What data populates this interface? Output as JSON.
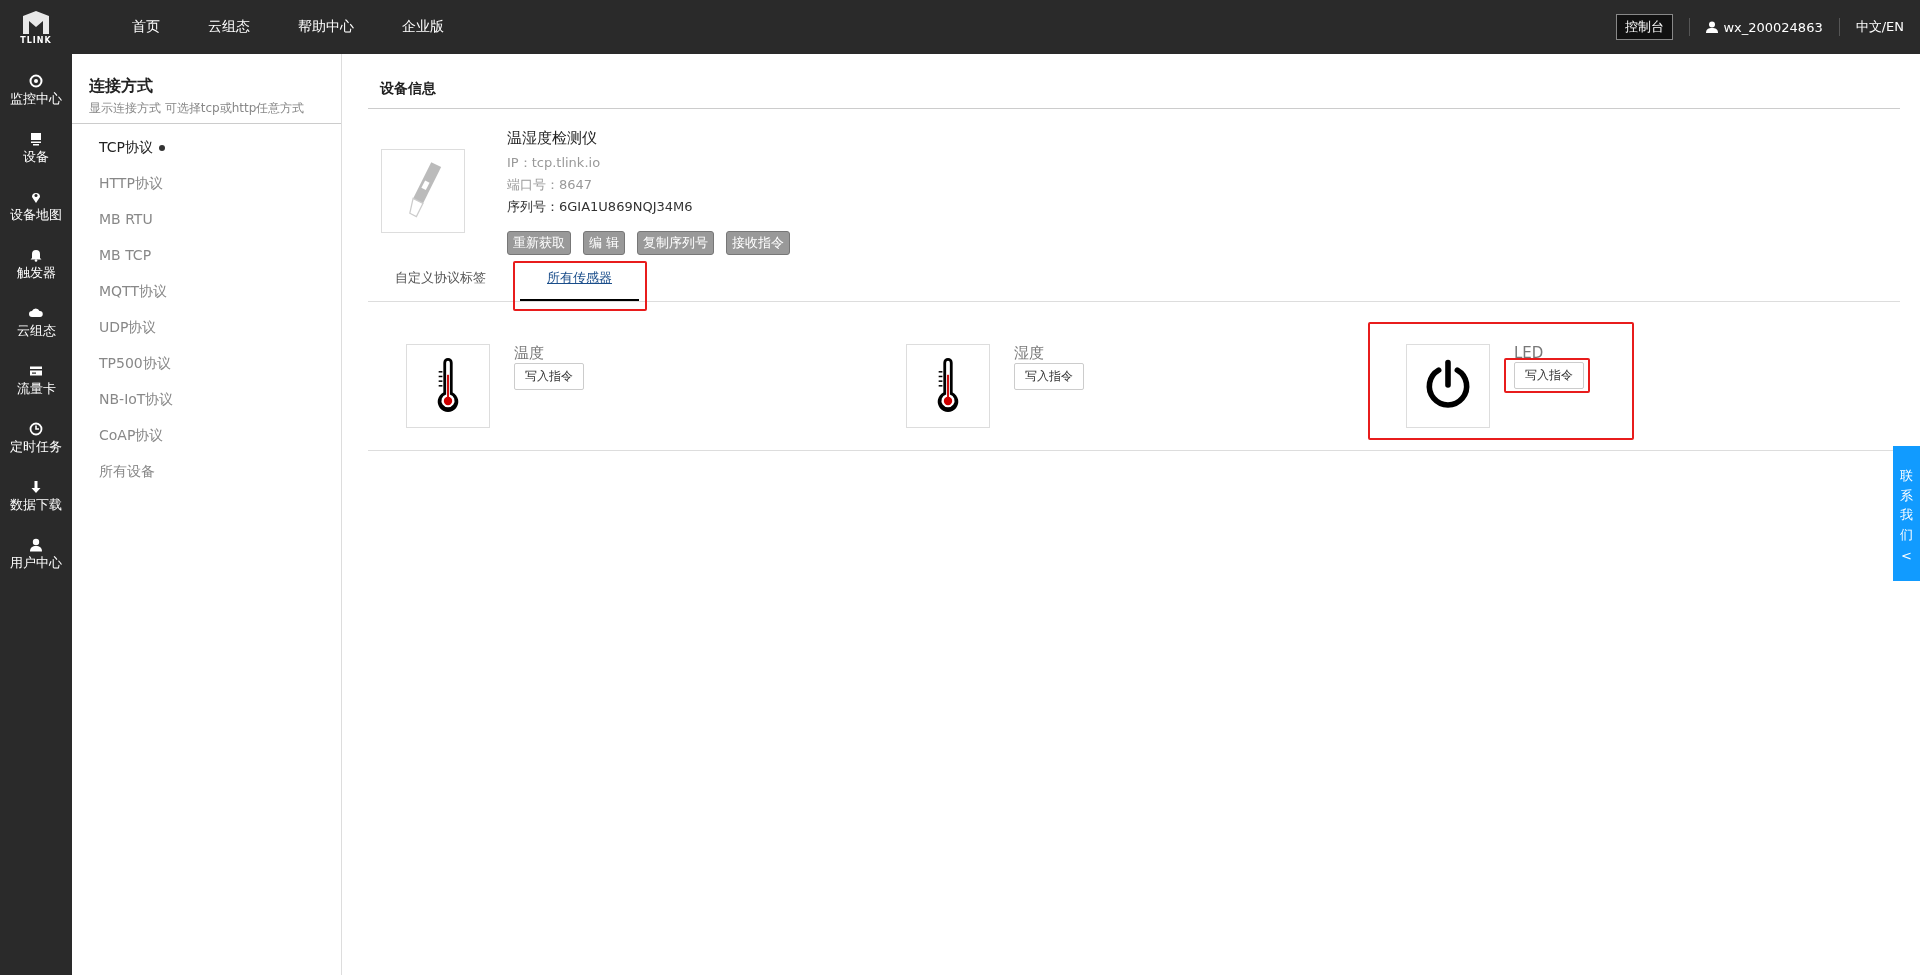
{
  "top_nav": {
    "logo_text": "TLINK",
    "items": [
      "首页",
      "云组态",
      "帮助中心",
      "企业版"
    ],
    "console_button": "控制台",
    "user": "wx_200024863",
    "language": "中文/EN"
  },
  "side_nav": [
    {
      "label": "监控中心"
    },
    {
      "label": "设备"
    },
    {
      "label": "设备地图"
    },
    {
      "label": "触发器"
    },
    {
      "label": "云组态"
    },
    {
      "label": "流量卡"
    },
    {
      "label": "定时任务"
    },
    {
      "label": "数据下载"
    },
    {
      "label": "用户中心"
    }
  ],
  "connection_panel": {
    "title": "连接方式",
    "subtitle": "显示连接方式 可选择tcp或http任意方式",
    "items": [
      {
        "label": "TCP协议",
        "selected": true
      },
      {
        "label": "HTTP协议",
        "selected": false
      },
      {
        "label": "MB RTU",
        "selected": false
      },
      {
        "label": "MB TCP",
        "selected": false
      },
      {
        "label": "MQTT协议",
        "selected": false
      },
      {
        "label": "UDP协议",
        "selected": false
      },
      {
        "label": "TP500协议",
        "selected": false
      },
      {
        "label": "NB-IoT协议",
        "selected": false
      },
      {
        "label": "CoAP协议",
        "selected": false
      },
      {
        "label": "所有设备",
        "selected": false
      }
    ]
  },
  "device_info": {
    "title": "设备信息",
    "name": "温湿度检测仪",
    "ip": "IP：tcp.tlink.io",
    "port": "端口号：8647",
    "serial": "序列号：6GIA1U869NQJ34M6",
    "buttons": [
      "重新获取",
      "编 辑",
      "复制序列号",
      "接收指令"
    ]
  },
  "tabs": [
    {
      "label": "自定义协议标签",
      "selected": false,
      "highlighted": false
    },
    {
      "label": "所有传感器",
      "selected": true,
      "highlighted": true
    }
  ],
  "sensors": [
    {
      "name": "温度",
      "kind": "thermometer",
      "button": "写入指令",
      "highlighted": false
    },
    {
      "name": "湿度",
      "kind": "thermometer",
      "button": "写入指令",
      "highlighted": false
    },
    {
      "name": "LED",
      "kind": "switch",
      "button": "写入指令",
      "highlighted": true
    }
  ],
  "contact_tab": {
    "label": "联系我们",
    "arrow": "<"
  }
}
